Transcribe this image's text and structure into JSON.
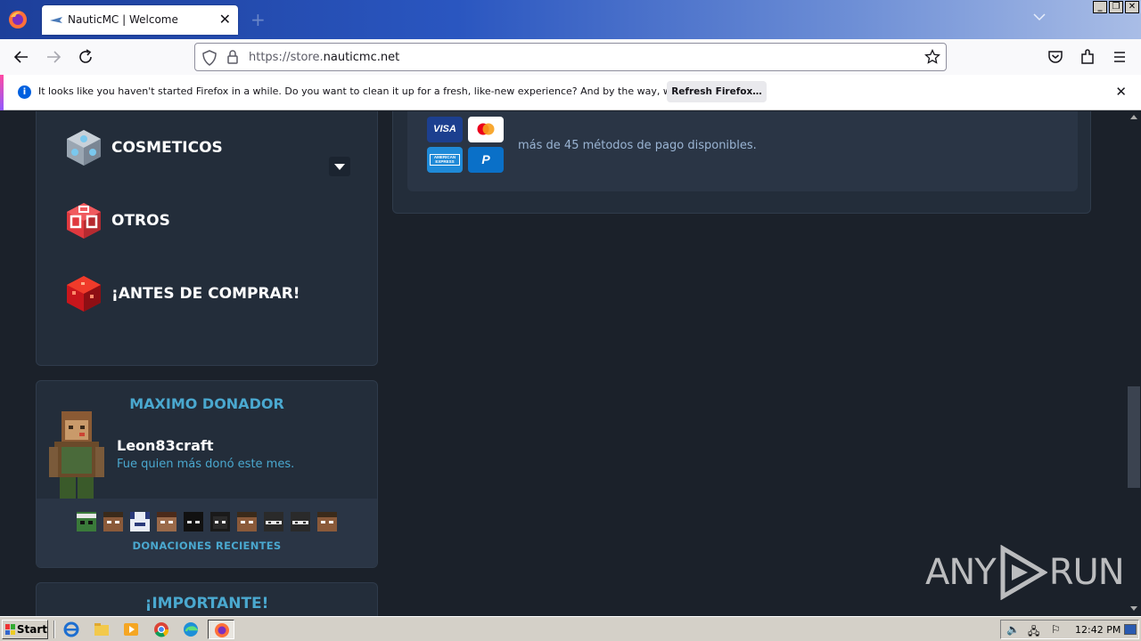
{
  "browser": {
    "tab_title": "NauticMC | Welcome",
    "url_prefix": "https://store.",
    "url_domain": "nauticmc.net",
    "notification_text": "It looks like you haven't started Firefox in a while. Do you want to clean it up for a fresh, like-new experience? And by the way, welcome back!",
    "notification_button": "Refresh Firefox…"
  },
  "categories": [
    {
      "label": "COSMETICOS",
      "icon": "portal-cube-icon",
      "has_dropdown": true
    },
    {
      "label": "OTROS",
      "icon": "red-box-icon",
      "has_dropdown": false
    },
    {
      "label": "¡ANTES DE COMPRAR!",
      "icon": "red-block-icon",
      "has_dropdown": false
    }
  ],
  "top_donor": {
    "title": "MAXIMO DONADOR",
    "name": "Leon83craft",
    "subtitle": "Fue quien más donó este mes.",
    "recent_label": "DONACIONES RECIENTES"
  },
  "important": {
    "title": "¡IMPORTANTE!"
  },
  "payment": {
    "text": "más de 45 métodos de pago disponibles.",
    "cards": [
      "VISA",
      "Mastercard",
      "American Express",
      "PayPal"
    ]
  },
  "watermark": {
    "text_left": "ANY",
    "text_right": "RUN"
  },
  "taskbar": {
    "start_label": "Start",
    "clock": "12:42 PM"
  },
  "colors": {
    "accent": "#4aa8cf",
    "page_bg": "#1b212a",
    "panel_bg": "#232d3a"
  }
}
